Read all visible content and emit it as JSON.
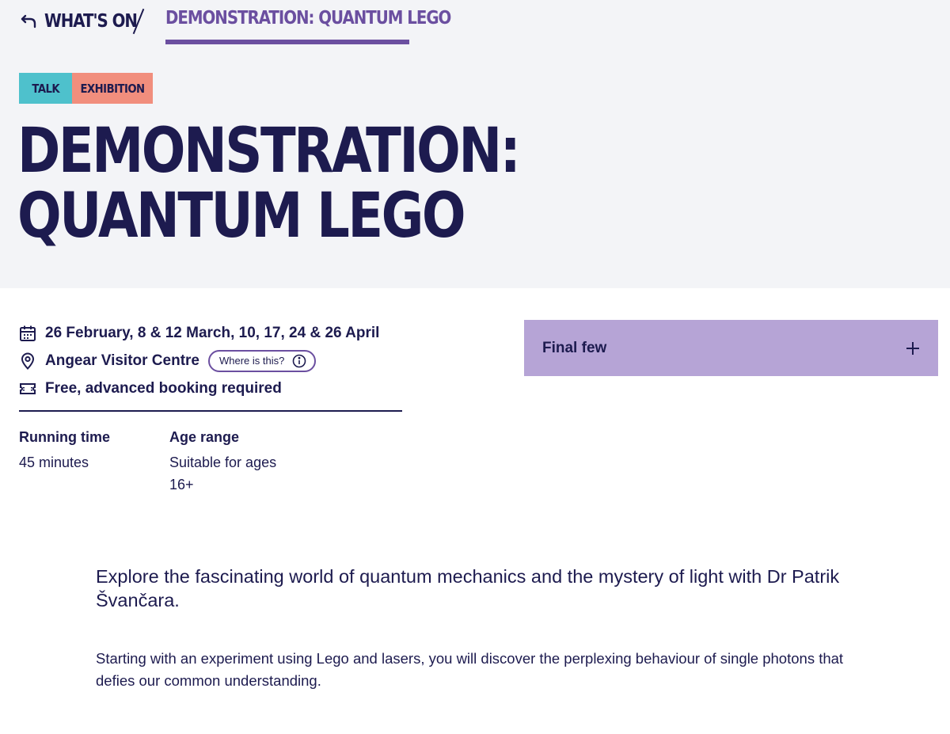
{
  "breadcrumb": {
    "back_label": "What's on",
    "current_label": "Demonstration: Quantum Lego"
  },
  "tags": [
    {
      "label": "Talk",
      "color": "#4ec1cc"
    },
    {
      "label": "Exhibition",
      "color": "#f18e7d"
    }
  ],
  "page_title": "Demonstration: Quantum Lego",
  "info": {
    "dates": "26 February, 8 & 12 March, 10, 17, 24 & 26 April",
    "location": "Angear Visitor Centre",
    "where_button": "Where is this?",
    "price": "Free, advanced booking required"
  },
  "meta": {
    "running_time_label": "Running time",
    "running_time_value": "45 minutes",
    "age_range_label": "Age range",
    "age_range_value": "Suitable for ages 16+"
  },
  "booking": {
    "label": "Final few",
    "icon": "plus-icon"
  },
  "description": {
    "lead": "Explore the fascinating world of quantum mechanics and the mystery of light with Dr Patrik Švančara.",
    "body": "Starting with an experiment using Lego and lasers, you will discover the perplexing behaviour of single photons that defies our common understanding."
  },
  "colors": {
    "navy": "#1d1b4f",
    "purple": "#6b4fa0",
    "booking_bg": "#b6a4d6",
    "hero_bg": "#f3f4f7"
  }
}
